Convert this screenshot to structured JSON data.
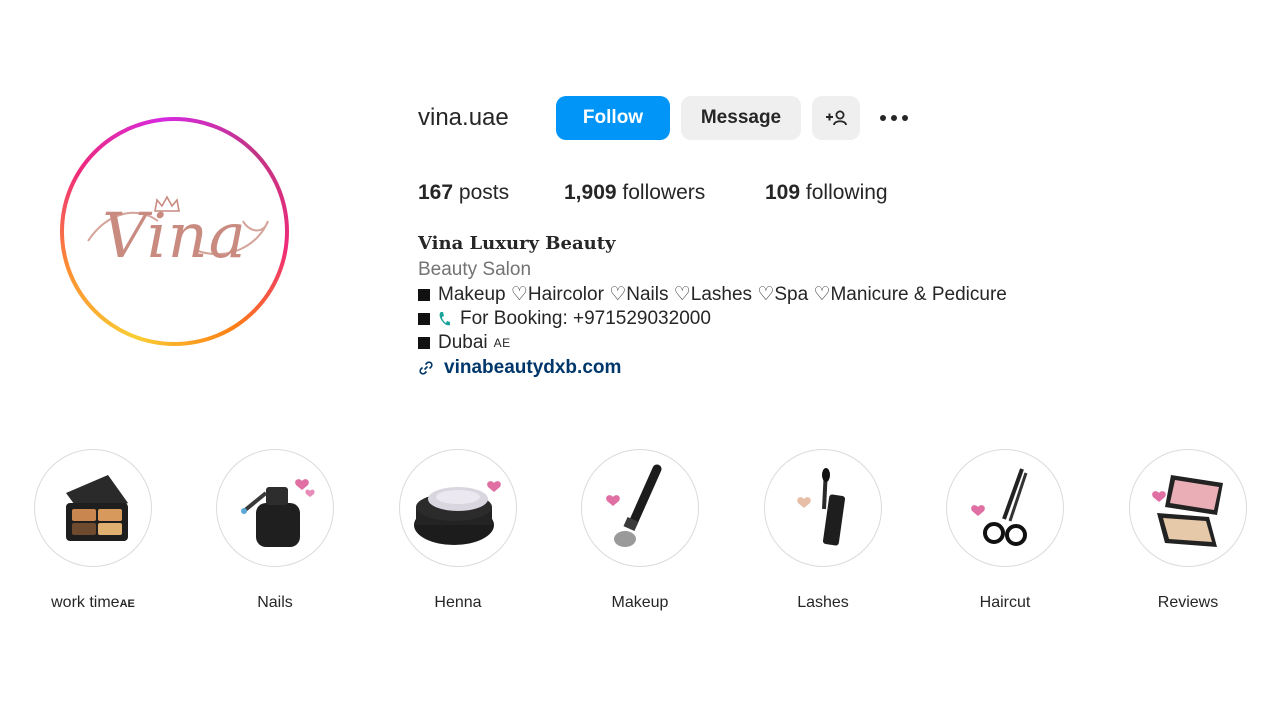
{
  "profile": {
    "username": "vina.uae",
    "avatar_logo_text": "Vina",
    "follow_label": "Follow",
    "message_label": "Message",
    "more_icon": "more-icon",
    "add_user_icon": "add-user-icon"
  },
  "stats": {
    "posts_count": "167",
    "posts_label": "posts",
    "followers_count": "1,909",
    "followers_label": "followers",
    "following_count": "109",
    "following_label": "following"
  },
  "bio": {
    "name": "Vina Luxury Beauty",
    "category": "Beauty Salon",
    "line1": "Makeup ♡Haircolor ♡Nails ♡Lashes ♡Spa ♡Manicure & Pedicure",
    "line2": "For Booking: +971529032000",
    "line3": "Dubai",
    "line3_flag": "AE",
    "link": "vinabeautydxb.com"
  },
  "highlights": [
    {
      "label": "work time",
      "suffix": "AE",
      "icon": "eyeshadow-palette-icon"
    },
    {
      "label": "Nails",
      "icon": "nail-polish-icon"
    },
    {
      "label": "Henna",
      "icon": "henna-jar-icon"
    },
    {
      "label": "Makeup",
      "icon": "makeup-brush-icon"
    },
    {
      "label": "Lashes",
      "icon": "mascara-icon"
    },
    {
      "label": "Haircut",
      "icon": "scissors-icon"
    },
    {
      "label": "Reviews",
      "icon": "compact-icon"
    }
  ],
  "colors": {
    "follow_blue": "#0095f6",
    "button_gray": "#efefef",
    "link_blue": "#00376b",
    "muted_text": "#737373",
    "logo_rose": "#c98a80"
  }
}
